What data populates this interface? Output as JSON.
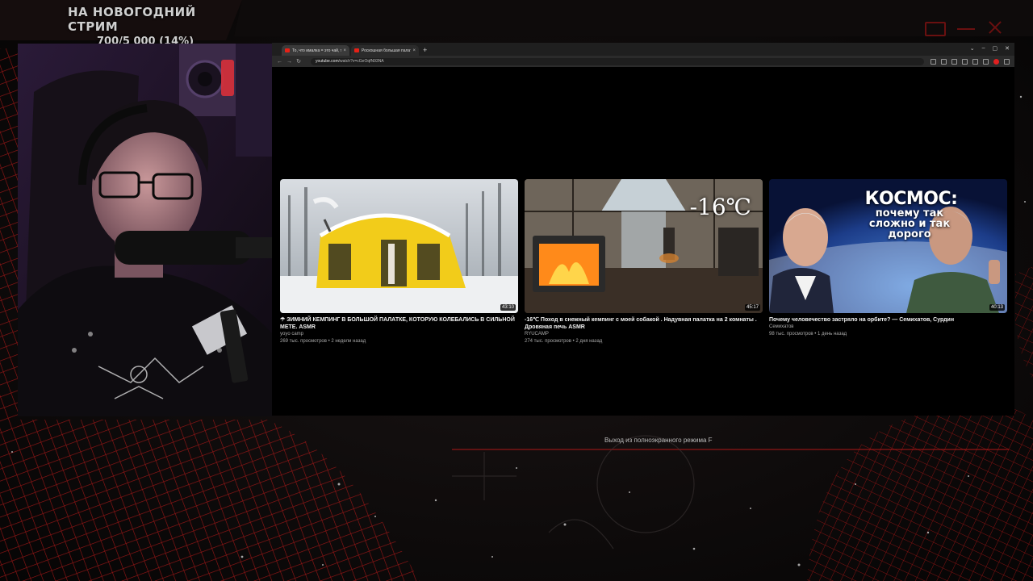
{
  "overlay": {
    "donation_title": "НА НОВОГОДНИЙ СТРИМ",
    "donation_progress": "700/5 000 (14%)",
    "progress_fraction": 0.14,
    "accent": "#b01818",
    "icons": [
      "window-icon",
      "minimize-icon",
      "close-icon"
    ]
  },
  "browser": {
    "tabs": [
      {
        "label": "То, что ималка = это чай, то",
        "active": true
      },
      {
        "label": "Роскошная большая палатка",
        "active": false
      }
    ],
    "url_host": "youtube.com",
    "url_path": "/watch?v=cGeOqfN93NA",
    "fullscreen_hint": "Выход из полноэкранного режима F"
  },
  "videos": [
    {
      "title": "☂ ЗИМНИЙ КЕМПИНГ В БОЛЬШОЙ ПАЛАТКЕ, КОТОРУЮ КОЛЕБАЛИСЬ В СИЛЬНОЙ МЕТЕ. ASMR",
      "channel": "yoyo camp",
      "meta": "269 тыс. просмотров • 2 недели назад",
      "duration": "43:10"
    },
    {
      "title": "-16℃ Поход в снежный кемпинг с моей собакой . Надувная палатка на 2 комнаты . Дровяная печь ASMR",
      "channel": "RYUCAMP",
      "meta": "274 тыс. просмотров • 2 дня назад",
      "duration": "45:17",
      "overlay_text": "-16℃"
    },
    {
      "title": "Почему человечество застряло на орбите? — Семихатов, Сурдин",
      "channel": "Семихатов",
      "meta": "98 тыс. просмотров • 1 день назад",
      "duration": "40:13",
      "overlay_title": "КОСМОС:",
      "overlay_sub": "почему так сложно и так дорого"
    }
  ]
}
